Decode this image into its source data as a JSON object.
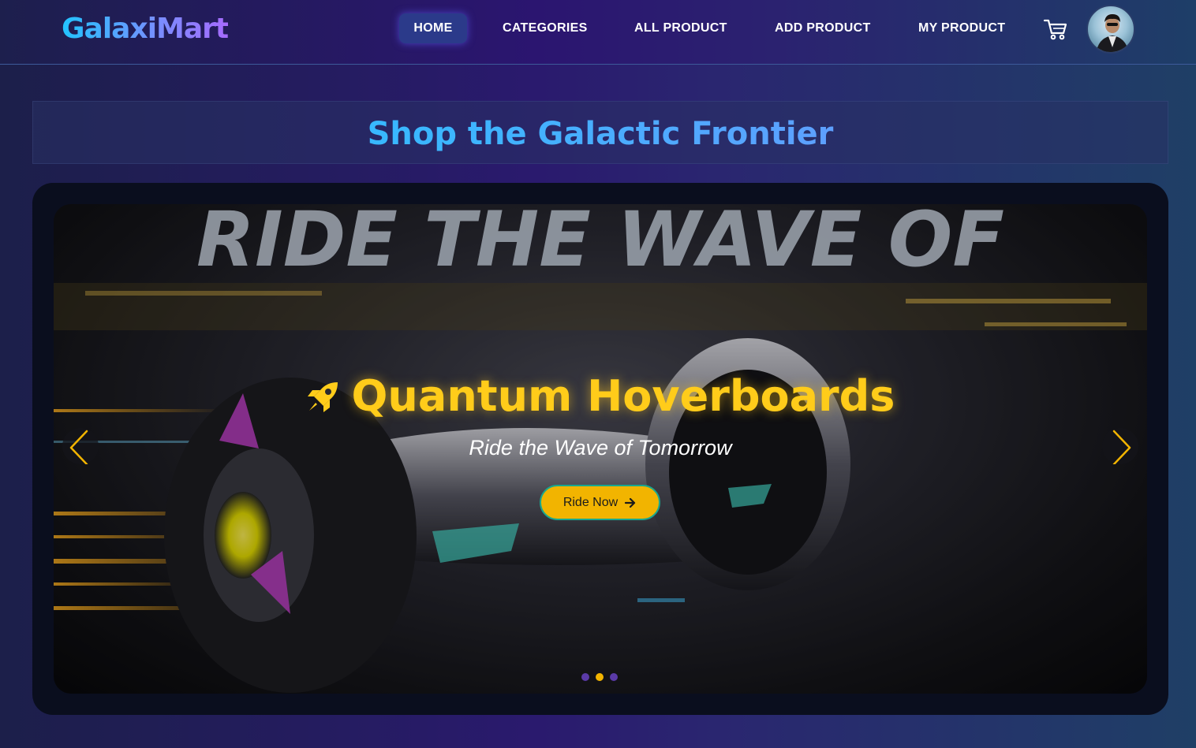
{
  "brand": {
    "name": "GalaxiMart"
  },
  "nav": {
    "items": [
      {
        "label": "HOME",
        "active": true
      },
      {
        "label": "CATEGORIES",
        "active": false
      },
      {
        "label": "ALL PRODUCT",
        "active": false
      },
      {
        "label": "ADD PRODUCT",
        "active": false
      },
      {
        "label": "MY PRODUCT",
        "active": false
      }
    ],
    "cart_icon": "shopping-cart-icon",
    "avatar_icon": "user-avatar"
  },
  "hero": {
    "headline": "Shop the Galactic Frontier"
  },
  "carousel": {
    "slide": {
      "title": "Quantum Hoverboards",
      "title_icon": "rocket-icon",
      "subtitle": "Ride the Wave of Tomorrow",
      "cta_label": "Ride Now",
      "background_text": "RIDE THE WAVE OF"
    },
    "dots_total": 3,
    "active_dot": 2
  },
  "colors": {
    "accent_yellow": "#f2b400",
    "title_yellow": "#ffcc1a",
    "brand_cyan": "#22c4ff",
    "brand_violet": "#a66bff",
    "nav_active_bg": "#2b3a8a"
  }
}
